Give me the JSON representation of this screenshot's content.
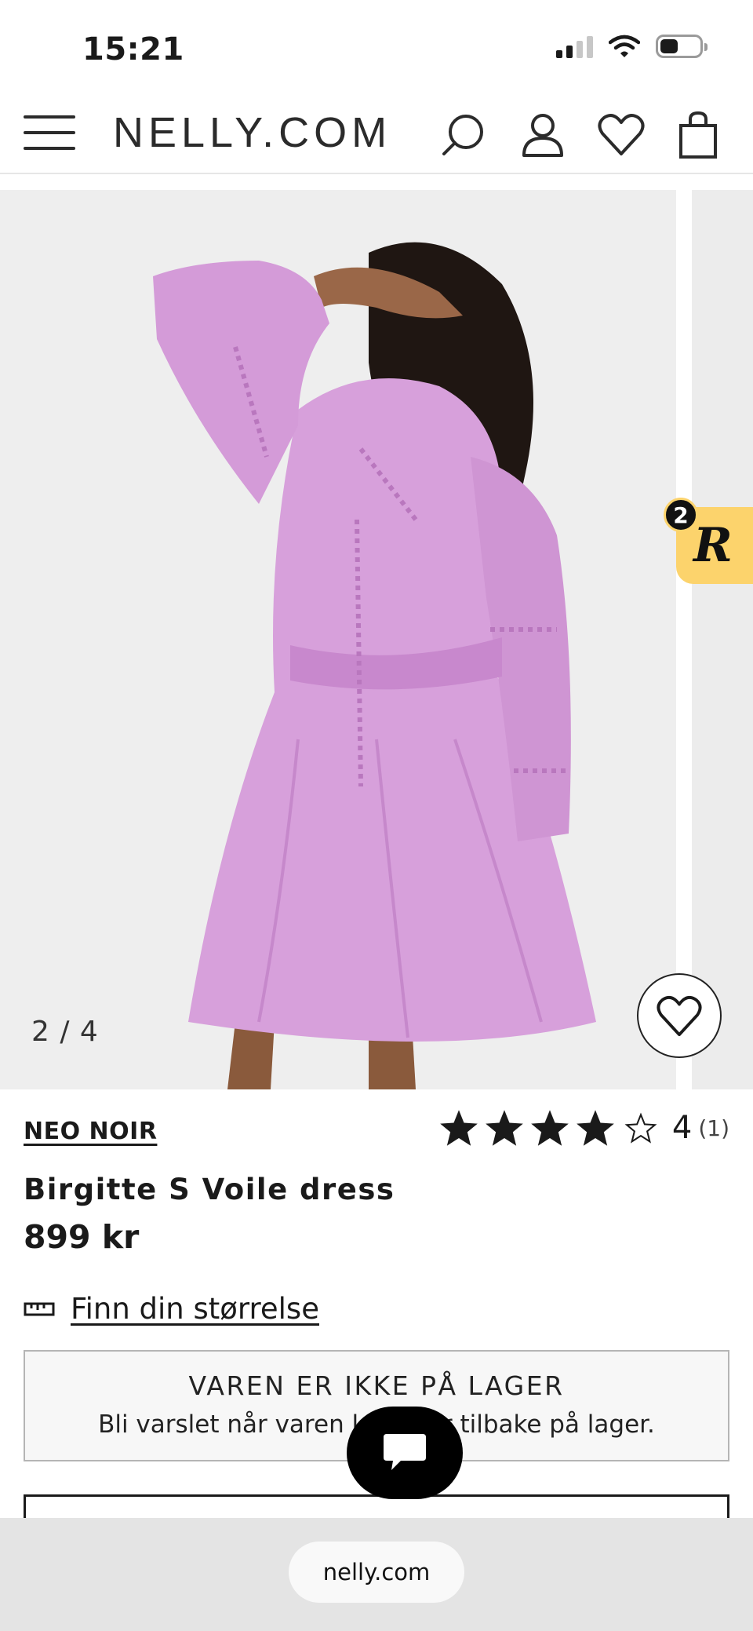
{
  "status_bar": {
    "time": "15:21"
  },
  "header": {
    "logo": "NELLY.COM"
  },
  "gallery": {
    "counter": "2 / 4"
  },
  "badge": {
    "letter": "R",
    "count": "2"
  },
  "product": {
    "brand": "NEO NOIR",
    "name": "Birgitte S Voile dress",
    "price": "899 kr",
    "rating_value": "4",
    "rating_count": "(1)",
    "stars_filled": 4,
    "stars_total": 5
  },
  "size_guide": {
    "label": "Finn din størrelse"
  },
  "stock": {
    "title": "VAREN ER IKKE PÅ LAGER",
    "subtitle": "Bli varslet når varen kommer tilbake på lager."
  },
  "browser": {
    "url": "nelly.com"
  },
  "colors": {
    "dress": "#d7a0db",
    "badge": "#fcd36c",
    "text": "#1a1a1a"
  }
}
